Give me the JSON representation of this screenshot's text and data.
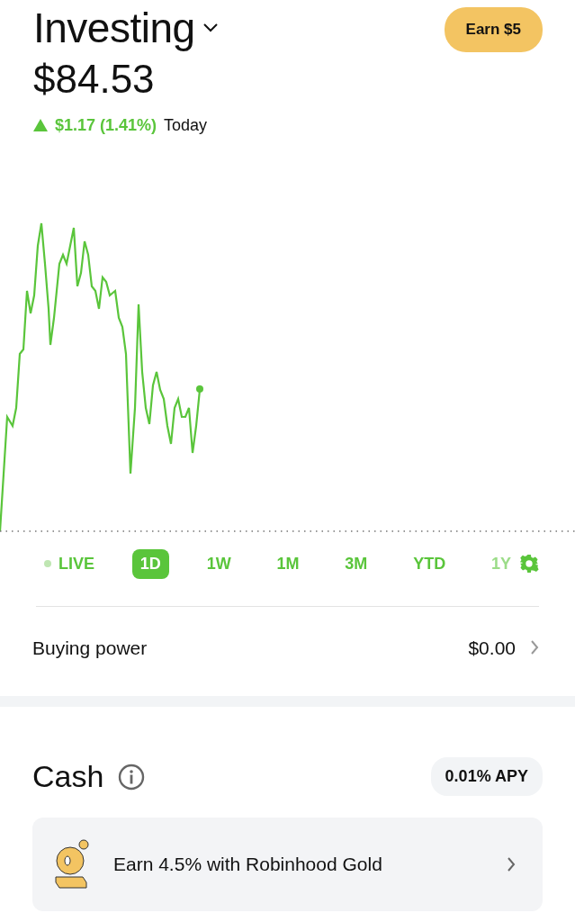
{
  "header": {
    "title": "Investing",
    "action": "Earn $5"
  },
  "portfolio": {
    "value": "$84.53",
    "change": "$1.17 (1.41%)",
    "rising": true,
    "period_label": "Today"
  },
  "periods": [
    {
      "label": "LIVE",
      "kind": "live",
      "selected": false
    },
    {
      "label": "1D",
      "kind": "range",
      "selected": true
    },
    {
      "label": "1W",
      "kind": "range",
      "selected": false
    },
    {
      "label": "1M",
      "kind": "range",
      "selected": false
    },
    {
      "label": "3M",
      "kind": "range",
      "selected": false
    },
    {
      "label": "YTD",
      "kind": "range",
      "selected": false
    },
    {
      "label": "1Y",
      "kind": "range",
      "selected": false
    }
  ],
  "buying_power": {
    "label": "Buying power",
    "value": "$0.00"
  },
  "cash": {
    "title": "Cash",
    "badge": "0.01% APY",
    "promo": "Earn 4.5% with Robinhood Gold"
  }
}
